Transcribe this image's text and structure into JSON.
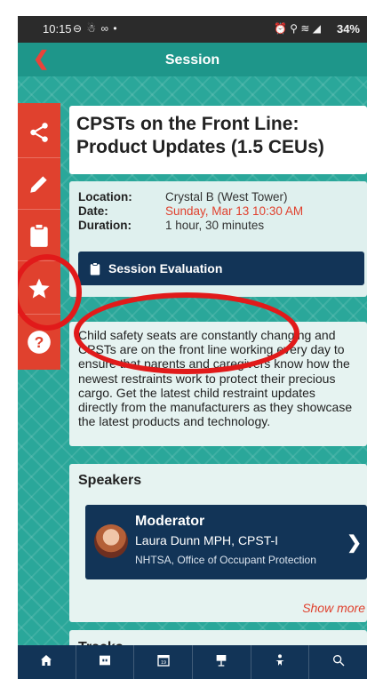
{
  "status_bar": {
    "time": "10:15",
    "left_icons": "⊖ ☃ ∞ •",
    "right_icons": "⏰ ⚲ ≋ ◢",
    "battery": "34%"
  },
  "app_bar": {
    "title": "Session"
  },
  "side_rail": [
    "share-icon",
    "pencil-icon",
    "clipboard-icon",
    "star-icon",
    "question-icon"
  ],
  "session": {
    "title": "CPSTs on the Front Line: Product Updates (1.5 CEUs)",
    "location_label": "Location:",
    "location_value": "Crystal B (West Tower)",
    "date_label": "Date:",
    "date_value": "Sunday, Mar 13 10:30 AM",
    "duration_label": "Duration:",
    "duration_value": "1 hour, 30 minutes",
    "evaluation_button": "Session Evaluation",
    "description": "Child safety seats are constantly changing and CPSTs are on the front line working every day to ensure that parents and caregivers know how the newest restraints work to protect their precious cargo. Get the latest child restraint updates directly from the manufacturers as they showcase the latest products and technology."
  },
  "speakers": {
    "heading": "Speakers",
    "items": [
      {
        "role": "Moderator",
        "name": "Laura Dunn MPH, CPST-I",
        "organization": "NHTSA, Office of Occupant Protection"
      }
    ],
    "show_more": "Show more"
  },
  "tracks": {
    "heading": "Tracks"
  },
  "tab_bar": [
    "home-icon",
    "map-icon",
    "calendar-icon",
    "exhibitor-icon",
    "attendee-icon",
    "search-icon"
  ],
  "colors": {
    "accent_red": "#e0412e",
    "teal": "#2aa79a",
    "navy": "#123457",
    "annotation_red": "#e11a1a"
  }
}
